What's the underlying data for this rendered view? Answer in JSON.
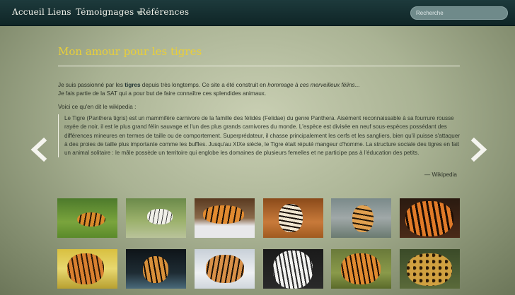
{
  "nav": {
    "items": [
      "Accueil",
      "Liens",
      "Témoignages",
      "Références"
    ],
    "search_placeholder": "Recherche"
  },
  "page": {
    "title": "Mon amour pour les tigres",
    "intro_1": "Je suis passionné par les ",
    "intro_bold": "tigres",
    "intro_2": " depuis très longtemps. Ce site a été construit en ",
    "intro_italic": "hommage à ces merveilleux félins",
    "intro_3": "...",
    "intro_line2": "Je fais partie de la SAT qui a pour but de faire connaître ces splendides animaux.",
    "wiki_intro": "Voici ce qu'en dit le wikipedia :",
    "quote": "Le Tigre (Panthera tigris) est un mammifère carnivore de la famille des félidés (Felidae) du genre Panthera. Aisément reconnaissable à sa fourrure rousse rayée de noir, il est le plus grand félin sauvage et l'un des plus grands carnivores du monde. L'espèce est divisée en neuf sous-espèces possédant des différences mineures en termes de taille ou de comportement. Superprédateur, il chasse principalement les cerfs et les sangliers, bien qu'il puisse s'attaquer à des proies de taille plus importante comme les buffles. Jusqu'au XIXe siècle, le Tigre était réputé mangeur d'homme. La structure sociale des tigres en fait un animal solitaire : le mâle possède un territoire qui englobe les domaines de plusieurs femelles et ne participe pas à l'éducation des petits.",
    "quote_source": "— Wikipedia"
  },
  "gallery": {
    "row1": [
      "tiger-in-grass-photo",
      "white-tiger-photo",
      "tiger-walking-snow-photo",
      "tiger-autumn-field-photo",
      "tiger-on-rocks-photo",
      "tiger-face-closeup-photo"
    ],
    "row2": [
      "tiger-cub-photo",
      "tiger-in-water-photo",
      "tiger-in-snow-photo",
      "white-tiger-face-photo",
      "roaring-tiger-photo",
      "jaguar-photo"
    ]
  },
  "colors": {
    "navbar": "#1d3a3c",
    "title": "#e9cf39",
    "body_text": "#2c3228"
  }
}
